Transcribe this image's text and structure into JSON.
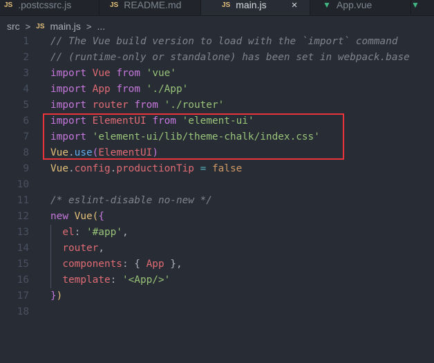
{
  "tabs": [
    {
      "icon": "JS",
      "label": ".postcssrc.js",
      "active": false
    },
    {
      "icon": "JS",
      "label": "README.md",
      "active": false
    },
    {
      "icon": "JS",
      "label": "main.js",
      "active": true,
      "close": "×"
    },
    {
      "icon": "V",
      "label": "App.vue",
      "active": false
    },
    {
      "icon": "V",
      "label": "",
      "active": false
    }
  ],
  "breadcrumb": {
    "folder": "src",
    "sep": ">",
    "file_icon": "JS",
    "file": "main.js",
    "more": "..."
  },
  "lines": [
    {
      "n": "1",
      "tokens": [
        [
          "cm",
          "// The Vue build version to load with the `import` command"
        ]
      ]
    },
    {
      "n": "2",
      "tokens": [
        [
          "cm",
          "// (runtime-only or standalone) has been set in webpack.base"
        ]
      ]
    },
    {
      "n": "3",
      "tokens": [
        [
          "kw",
          "import"
        ],
        [
          "pun",
          " "
        ],
        [
          "id",
          "Vue"
        ],
        [
          "pun",
          " "
        ],
        [
          "kw",
          "from"
        ],
        [
          "pun",
          " "
        ],
        [
          "str",
          "'vue'"
        ]
      ]
    },
    {
      "n": "4",
      "tokens": [
        [
          "kw",
          "import"
        ],
        [
          "pun",
          " "
        ],
        [
          "id",
          "App"
        ],
        [
          "pun",
          " "
        ],
        [
          "kw",
          "from"
        ],
        [
          "pun",
          " "
        ],
        [
          "str",
          "'./App'"
        ]
      ]
    },
    {
      "n": "5",
      "tokens": [
        [
          "kw",
          "import"
        ],
        [
          "pun",
          " "
        ],
        [
          "id",
          "router"
        ],
        [
          "pun",
          " "
        ],
        [
          "kw",
          "from"
        ],
        [
          "pun",
          " "
        ],
        [
          "str",
          "'./router'"
        ]
      ]
    },
    {
      "n": "6",
      "tokens": [
        [
          "kw",
          "import"
        ],
        [
          "pun",
          " "
        ],
        [
          "id",
          "ElementUI"
        ],
        [
          "pun",
          " "
        ],
        [
          "kw",
          "from"
        ],
        [
          "pun",
          " "
        ],
        [
          "str",
          "'element-ui'"
        ]
      ]
    },
    {
      "n": "7",
      "tokens": [
        [
          "kw",
          "import"
        ],
        [
          "pun",
          " "
        ],
        [
          "str",
          "'element-ui/lib/theme-chalk/index.css'"
        ]
      ]
    },
    {
      "n": "8",
      "tokens": [
        [
          "cls",
          "Vue"
        ],
        [
          "pun",
          "."
        ],
        [
          "fn",
          "use"
        ],
        [
          "br2",
          "("
        ],
        [
          "id",
          "ElementUI"
        ],
        [
          "br2",
          ")"
        ]
      ]
    },
    {
      "n": "9",
      "tokens": [
        [
          "cls",
          "Vue"
        ],
        [
          "pun",
          "."
        ],
        [
          "id",
          "config"
        ],
        [
          "pun",
          "."
        ],
        [
          "id",
          "productionTip"
        ],
        [
          "pun",
          " "
        ],
        [
          "op",
          "="
        ],
        [
          "pun",
          " "
        ],
        [
          "bool",
          "false"
        ]
      ]
    },
    {
      "n": "10",
      "tokens": []
    },
    {
      "n": "11",
      "tokens": [
        [
          "cm",
          "/* eslint-disable no-new */"
        ]
      ]
    },
    {
      "n": "12",
      "tokens": [
        [
          "kw",
          "new"
        ],
        [
          "pun",
          " "
        ],
        [
          "cls",
          "Vue"
        ],
        [
          "br1",
          "("
        ],
        [
          "br2",
          "{"
        ]
      ]
    },
    {
      "n": "13",
      "guide": true,
      "tokens": [
        [
          "pun",
          "  "
        ],
        [
          "id",
          "el"
        ],
        [
          "pun",
          ": "
        ],
        [
          "str",
          "'#app'"
        ],
        [
          "pun",
          ","
        ]
      ]
    },
    {
      "n": "14",
      "guide": true,
      "tokens": [
        [
          "pun",
          "  "
        ],
        [
          "id",
          "router"
        ],
        [
          "pun",
          ","
        ]
      ]
    },
    {
      "n": "15",
      "guide": true,
      "tokens": [
        [
          "pun",
          "  "
        ],
        [
          "id",
          "components"
        ],
        [
          "pun",
          ": { "
        ],
        [
          "id",
          "App"
        ],
        [
          "pun",
          " },"
        ]
      ]
    },
    {
      "n": "16",
      "guide": true,
      "tokens": [
        [
          "pun",
          "  "
        ],
        [
          "id",
          "template"
        ],
        [
          "pun",
          ": "
        ],
        [
          "str",
          "'<App/>'"
        ]
      ]
    },
    {
      "n": "17",
      "tokens": [
        [
          "br2",
          "}"
        ],
        [
          "br1",
          ")"
        ]
      ]
    },
    {
      "n": "18",
      "tokens": []
    }
  ],
  "colors": {
    "background": "#282c34",
    "highlight": "#e8353b"
  }
}
